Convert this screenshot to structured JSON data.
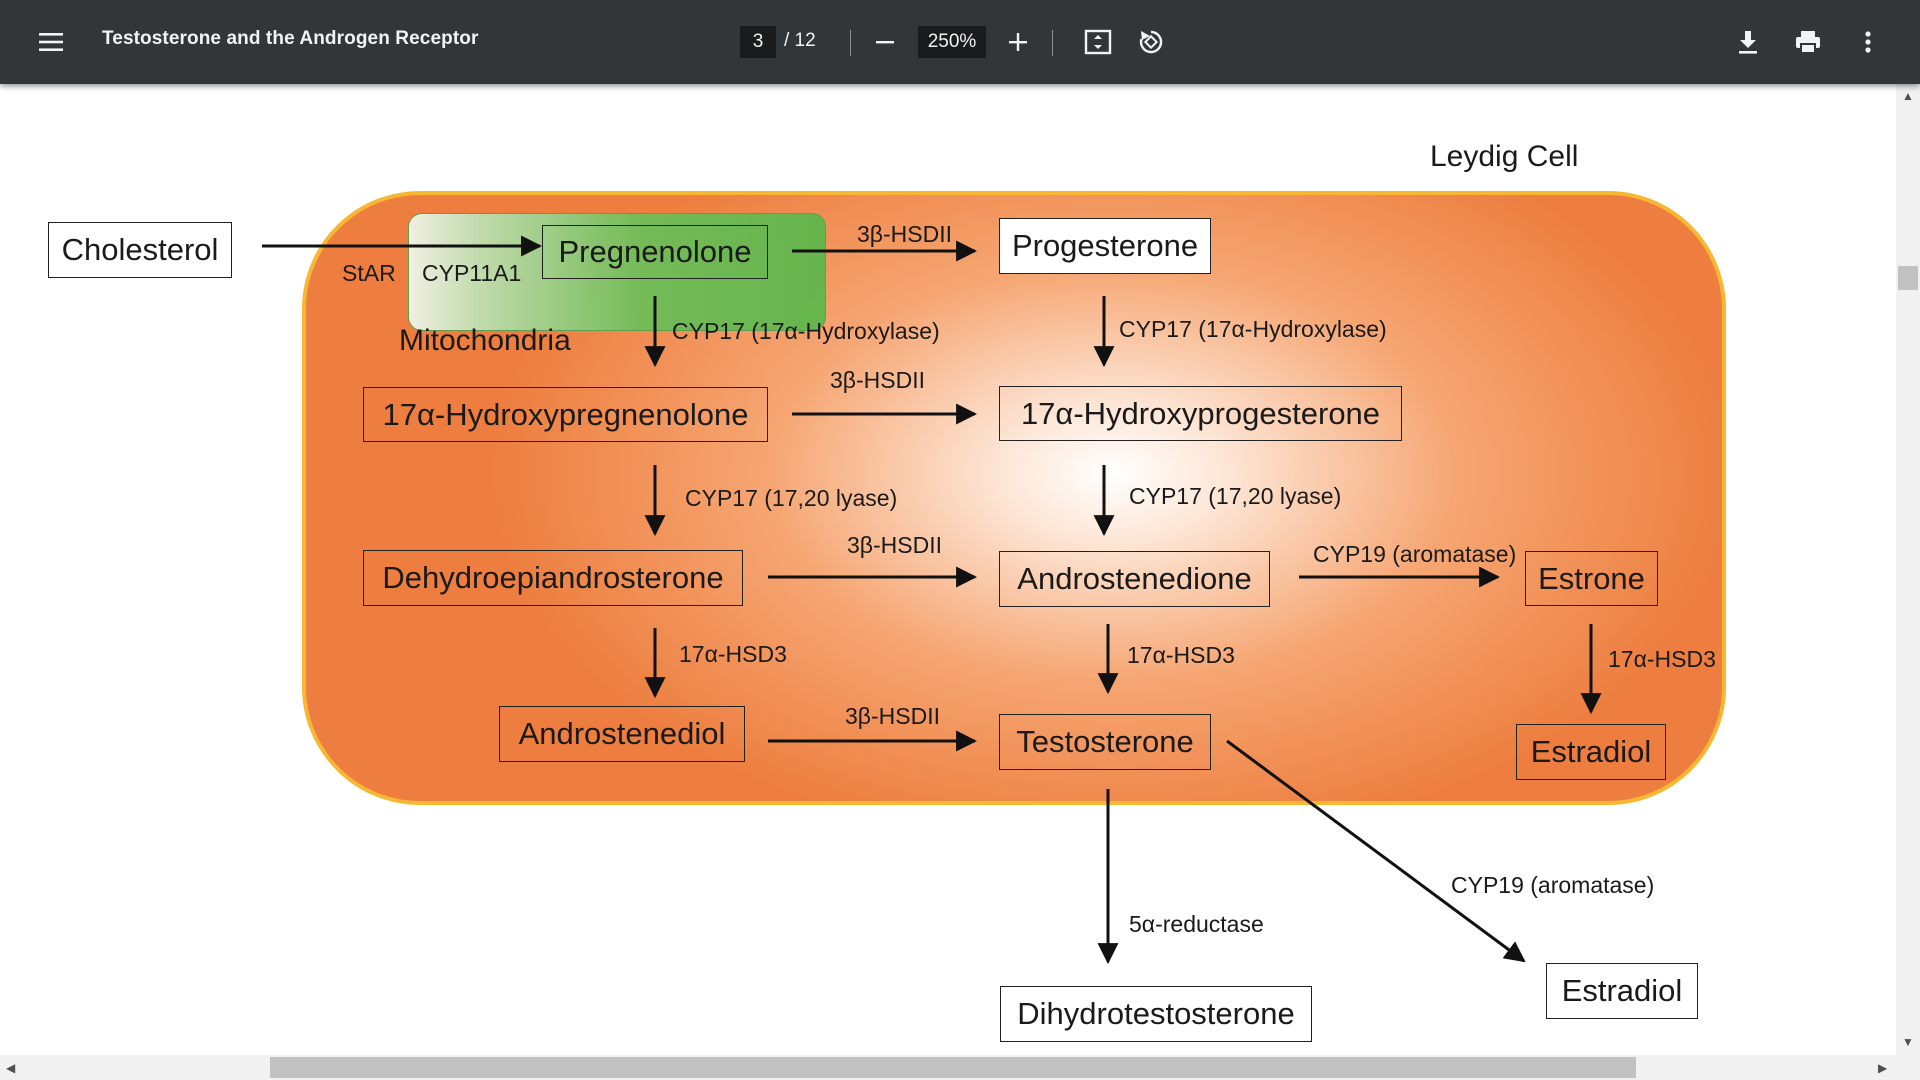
{
  "toolbar": {
    "menu_icon": "menu-icon",
    "title": "Testosterone and the Androgen Receptor",
    "page_current": "3",
    "page_total": "/ 12",
    "zoom": "250%",
    "icons": [
      "minus-icon",
      "plus-icon",
      "fit-page-icon",
      "rotate-icon",
      "download-icon",
      "print-icon",
      "more-vert-icon"
    ]
  },
  "diagram": {
    "cell_label": "Leydig Cell",
    "mito_label": "Mitochondria",
    "molecules": {
      "cholesterol": "Cholesterol",
      "pregnenolone": "Pregnenolone",
      "progesterone": "Progesterone",
      "hydroxypregnenolone": "17α-Hydroxypregnenolone",
      "hydroxyprogesterone": "17α-Hydroxyprogesterone",
      "dhea": "Dehydroepiandrosterone",
      "androstenedione": "Androstenedione",
      "estrone": "Estrone",
      "androstenediol": "Androstenediol",
      "testosterone": "Testosterone",
      "estradiol_in": "Estradiol",
      "dht": "Dihydrotestosterone",
      "estradiol_out": "Estradiol"
    },
    "enzymes": {
      "star": "StAR",
      "cyp11a1": "CYP11A1",
      "hsd_preg_prog": "3β-HSDII",
      "cyp17_hydrox_left": "CYP17 (17α-Hydroxylase)",
      "cyp17_hydrox_right": "CYP17 (17α-Hydroxylase)",
      "hsd_row2": "3β-HSDII",
      "lyase_left": "CYP17 (17,20 lyase)",
      "lyase_right": "CYP17 (17,20 lyase)",
      "hsd_row3": "3β-HSDII",
      "cyp19_row3": "CYP19 (aromatase)",
      "hsd17_left": "17α-HSD3",
      "hsd17_mid": "17α-HSD3",
      "hsd17_right": "17α-HSD3",
      "hsd_row4": "3β-HSDII",
      "reductase": "5α-reductase",
      "cyp19_out": "CYP19 (aromatase)"
    }
  }
}
